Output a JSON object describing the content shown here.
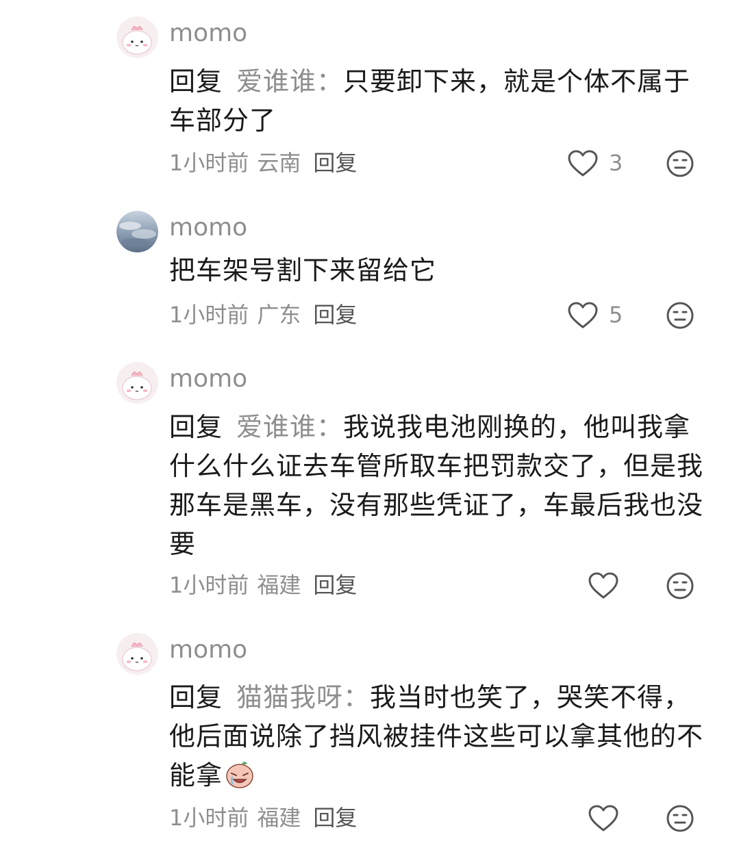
{
  "comments": [
    {
      "username": "momo",
      "reply_prefix": "回复",
      "reply_target": "爱谁谁",
      "colon": "：",
      "text": "只要卸下来，就是个体不属于车部分了",
      "time": "1小时前",
      "location": "云南",
      "reply_label": "回复",
      "likes": "3",
      "avatar": "pink-cartoon-avatar"
    },
    {
      "username": "momo",
      "text": "把车架号割下来留给它",
      "time": "1小时前",
      "location": "广东",
      "reply_label": "回复",
      "likes": "5",
      "avatar": "sky-cloud-avatar"
    },
    {
      "username": "momo",
      "reply_prefix": "回复",
      "reply_target": "爱谁谁",
      "colon": "：",
      "text": "我说我电池刚换的，他叫我拿什么什么证去车管所取车把罚款交了，但是我那车是黑车，没有那些凭证了，车最后我也没要",
      "time": "1小时前",
      "location": "福建",
      "reply_label": "回复",
      "likes": "",
      "avatar": "pink-cartoon-avatar"
    },
    {
      "username": "momo",
      "reply_prefix": "回复",
      "reply_target": "猫猫我呀",
      "colon": "：",
      "text": "我当时也笑了，哭笑不得，他后面说除了挡风被挂件这些可以拿其他的不能拿",
      "emoji": "crying-face-emoji",
      "time": "1小时前",
      "location": "福建",
      "reply_label": "回复",
      "likes": "",
      "avatar": "pink-cartoon-avatar"
    }
  ],
  "colors": {
    "text": "#1a1a1a",
    "secondary": "#8e8e8e",
    "icon": "#555555",
    "background": "#ffffff"
  }
}
